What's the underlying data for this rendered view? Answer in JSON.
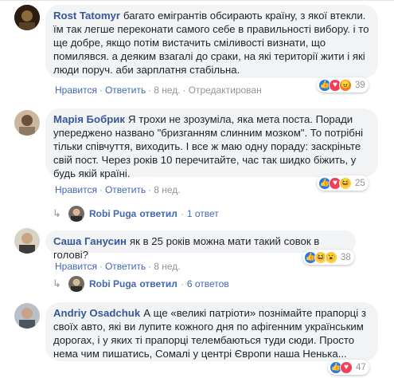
{
  "actions": {
    "like": "Нравится",
    "reply": "Ответить",
    "hide": "Отредактирован",
    "sep": "·"
  },
  "comments": [
    {
      "author": "Rost Tatomyr",
      "text": "багато емігрантів обсирають країну, з якої втекли. їм так легше переконати самого себе в правильності вибору. і то ще добре, якщо потім вистачить сміливості визнати, що помилявся. а деяким взагалі до сраки, на які території жити і які люди поруч. аби зарплатня стабільна.",
      "time": "8 нед.",
      "edited": "Отредактирован",
      "count": "39"
    },
    {
      "author": "Марія Бобрик",
      "text": "Я трохи не зрозуміла, яка мета поста. Поради упереджено названо \"бризганням слинним мозком\". То потрібні тільки співчуття, виходить. І все ж маю одну пораду: заскріньте свій пост. Через років 10 перечитайте, час так шидко біжить, у будь якій країні.",
      "time": "8 нед.",
      "count": "25",
      "reply": {
        "who": "Robi Puga",
        "verb": "ответил",
        "count": "1 ответ"
      }
    },
    {
      "author": "Саша Ганусин",
      "text": "як в 25 років можна мати такий совок в голові?",
      "time": "8 нед.",
      "count": "38",
      "reply": {
        "who": "Robi Puga",
        "verb": "ответил",
        "count": "6 ответов"
      }
    },
    {
      "author": "Andriy Osadchuk",
      "text": "А ще «великі патріоти» познімайте прапорці з своїх авто, які ви лупите кожного дня по афігенним українським дорогах, і у яких ті прапорці телембаються туди сюди. Просто нема чим пишатись, Сомалі у центрі Європи наша Ненька...",
      "count": "47"
    }
  ],
  "colors": {
    "link": "#365899",
    "action": "#4267b2",
    "bubble": "#f2f3f5",
    "muted": "#90949c"
  }
}
